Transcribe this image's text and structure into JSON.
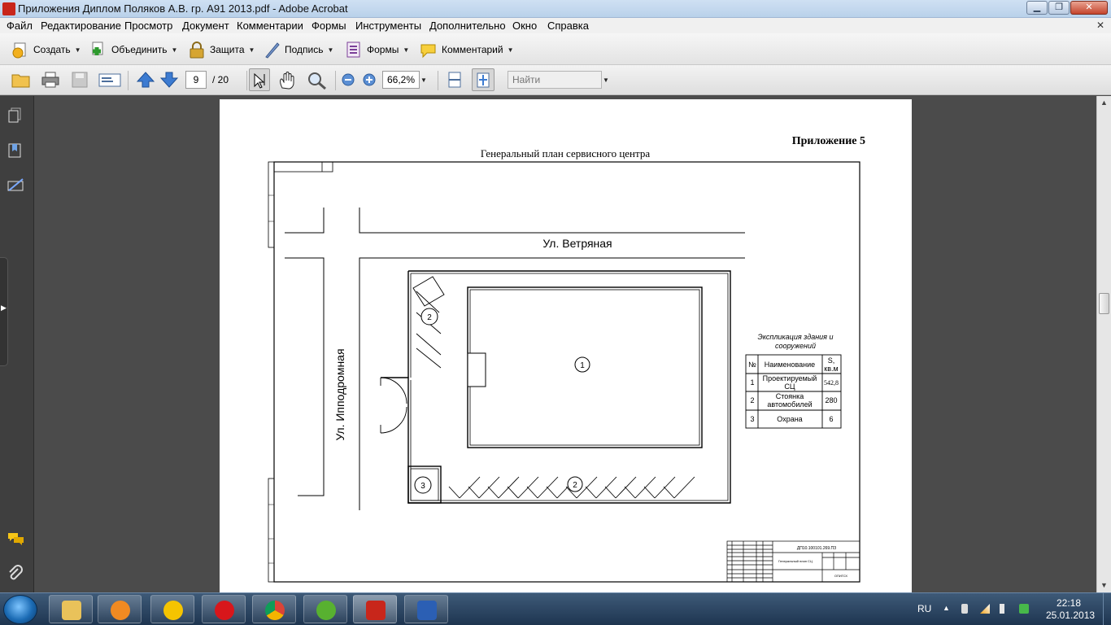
{
  "window": {
    "title": "Приложения Диплом Поляков А.В. гр. А91 2013.pdf - Adobe Acrobat"
  },
  "menu": [
    "Файл",
    "Редактирование",
    "Просмотр",
    "Документ",
    "Комментарии",
    "Формы",
    "Инструменты",
    "Дополнительно",
    "Окно",
    "Справка"
  ],
  "toolbar": {
    "create": "Создать",
    "combine": "Объединить",
    "secure": "Защита",
    "sign": "Подпись",
    "forms": "Формы",
    "comment": "Комментарий"
  },
  "nav": {
    "page_current": "9",
    "page_total": "/ 20",
    "zoom": "66,2%",
    "search_placeholder": "Найти"
  },
  "document": {
    "appendix": "Приложение 5",
    "title": "Генеральный план сервисного центра",
    "street_top": "Ул. Ветряная",
    "street_left": "Ул. Ипподромная",
    "markers": [
      "1",
      "2",
      "2",
      "3"
    ],
    "legend": {
      "title_line1": "Экспликация здания и",
      "title_line2": "сооружений",
      "headers": [
        "№",
        "Наименование",
        "S,",
        "кв.м"
      ],
      "rows": [
        {
          "num": "1",
          "name1": "Проектируемый",
          "name2": "СЦ",
          "area": "542,8"
        },
        {
          "num": "2",
          "name1": "Стоянка",
          "name2": "автомобилей",
          "area": "280"
        },
        {
          "num": "3",
          "name1": "Охрана",
          "name2": "",
          "area": "6"
        }
      ]
    },
    "stamp": {
      "code": "ДП10.100101.269.ПЗ",
      "sheet_title": "Генеральный план СЦ",
      "org": "ОПИГСХ"
    }
  },
  "taskbar": {
    "lang": "RU",
    "time": "22:18",
    "date": "25.01.2013"
  }
}
